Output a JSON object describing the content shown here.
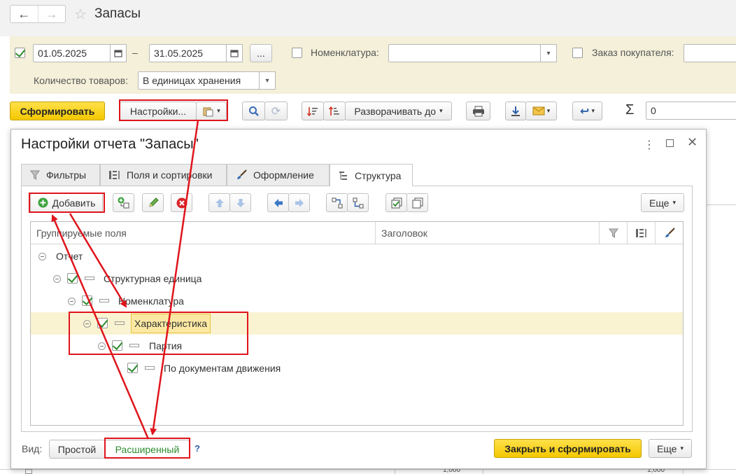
{
  "header": {
    "title": "Запасы"
  },
  "filters": {
    "period_from": "01.05.2025",
    "period_dash": "–",
    "period_to": "31.05.2025",
    "period_more": "...",
    "nomenclature_label": "Номенклатура:",
    "nomenclature_value": "",
    "order_label": "Заказ покупателя:",
    "qty_label": "Количество товаров:",
    "qty_value": "В единицах хранения"
  },
  "toolbar": {
    "generate_label": "Сформировать",
    "settings_label": "Настройки...",
    "expand_label": "Разворачивать до",
    "sum_symbol": "Σ",
    "sum_value": "0"
  },
  "background_values": [
    "1,000",
    "1,000"
  ],
  "dialog": {
    "title": "Настройки отчета \"Запасы\"",
    "tabs": [
      {
        "label": "Фильтры",
        "icon": "filter-icon"
      },
      {
        "label": "Поля и сортировки",
        "icon": "fields-sort-icon"
      },
      {
        "label": "Оформление",
        "icon": "brush-icon"
      },
      {
        "label": "Структура",
        "icon": "structure-icon"
      }
    ],
    "add_label": "Добавить",
    "more_label": "Еще",
    "columns": [
      "Группируемые поля",
      "Заголовок"
    ],
    "tree": [
      {
        "label": "Отчет",
        "level": 0,
        "checked": false
      },
      {
        "label": "Структурная единица",
        "level": 1,
        "checked": true
      },
      {
        "label": "Номенклатура",
        "level": 2,
        "checked": true
      },
      {
        "label": "Характеристика",
        "level": 3,
        "checked": true,
        "selected": true
      },
      {
        "label": "Партия",
        "level": 4,
        "checked": true
      },
      {
        "label": "По документам движения",
        "level": 5,
        "checked": true
      }
    ],
    "view_label": "Вид:",
    "view_simple": "Простой",
    "view_extended": "Расширенный",
    "help": "?",
    "close_generate": "Закрыть и сформировать",
    "more_bottom": "Еще"
  },
  "colors": {
    "accent_yellow": "#f3c800",
    "filter_bg": "#f4f0d9",
    "selected_row": "#faf3d1",
    "annotation_red": "#e0141c",
    "check_green": "#2e8b2e"
  }
}
